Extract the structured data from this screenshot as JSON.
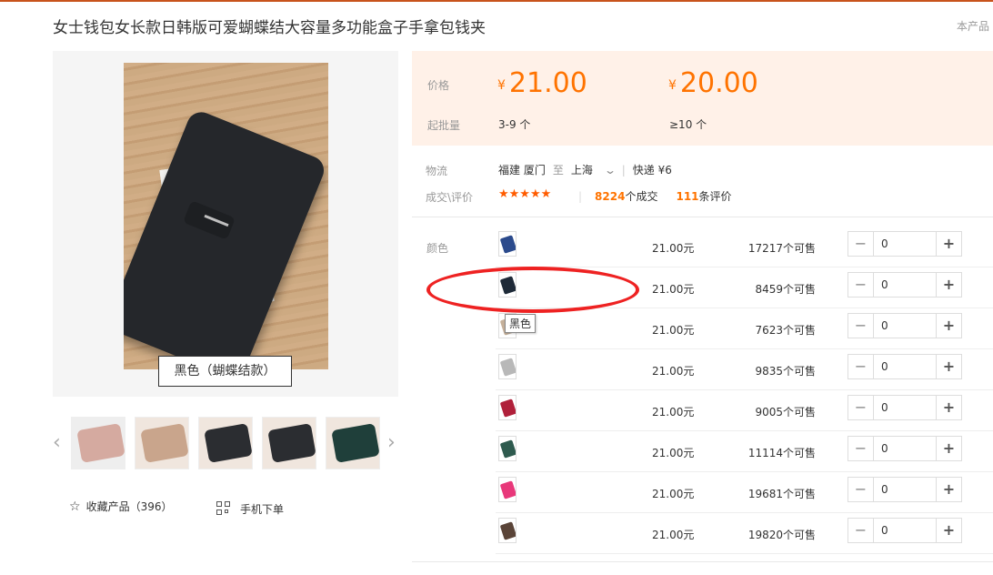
{
  "product": {
    "title": "女士钱包女长款日韩版可爱蝴蝶结大容量多功能盒子手拿包钱夹",
    "corner_text": "本产品",
    "main_image_caption": "黑色（蝴蝶结款）",
    "favorite_label": "收藏产品（396）",
    "mobile_order_label": "手机下单"
  },
  "thumbnails": [
    {
      "color": "#d5aaa0"
    },
    {
      "color": "#c9a58c"
    },
    {
      "color": "#2b2d31"
    },
    {
      "color": "#2b2d31"
    },
    {
      "color": "#1f3f3a"
    }
  ],
  "pricing": {
    "price_label": "价格",
    "moq_label": "起批量",
    "currency": "¥",
    "tiers": [
      {
        "price": "21.00",
        "range": "3-9 个"
      },
      {
        "price": "20.00",
        "range": "≥10 个"
      }
    ]
  },
  "logistics": {
    "label": "物流",
    "origin": "福建 厦门",
    "to": "至",
    "destination": "上海",
    "method": "快递 ¥6"
  },
  "reviews": {
    "label": "成交\\评价",
    "stars": "★★★★★",
    "deals_count": "8224",
    "deals_suffix": "个成交",
    "review_count": "111",
    "review_suffix": "条评价"
  },
  "sku": {
    "label": "颜色",
    "tooltip": "黑色",
    "rows": [
      {
        "color": "#2b4a8c",
        "price": "21.00元",
        "stock": "17217个可售",
        "qty": "0"
      },
      {
        "color": "#1e2a38",
        "price": "21.00元",
        "stock": "8459个可售",
        "qty": "0"
      },
      {
        "color": "#c5b09a",
        "price": "21.00元",
        "stock": "7623个可售",
        "qty": "0"
      },
      {
        "color": "#b8b8b8",
        "price": "21.00元",
        "stock": "9835个可售",
        "qty": "0"
      },
      {
        "color": "#b0203a",
        "price": "21.00元",
        "stock": "9005个可售",
        "qty": "0"
      },
      {
        "color": "#2e5a4e",
        "price": "21.00元",
        "stock": "11114个可售",
        "qty": "0"
      },
      {
        "color": "#e8387a",
        "price": "21.00元",
        "stock": "19681个可售",
        "qty": "0"
      },
      {
        "color": "#5a4438",
        "price": "21.00元",
        "stock": "19820个可售",
        "qty": "0"
      }
    ]
  }
}
